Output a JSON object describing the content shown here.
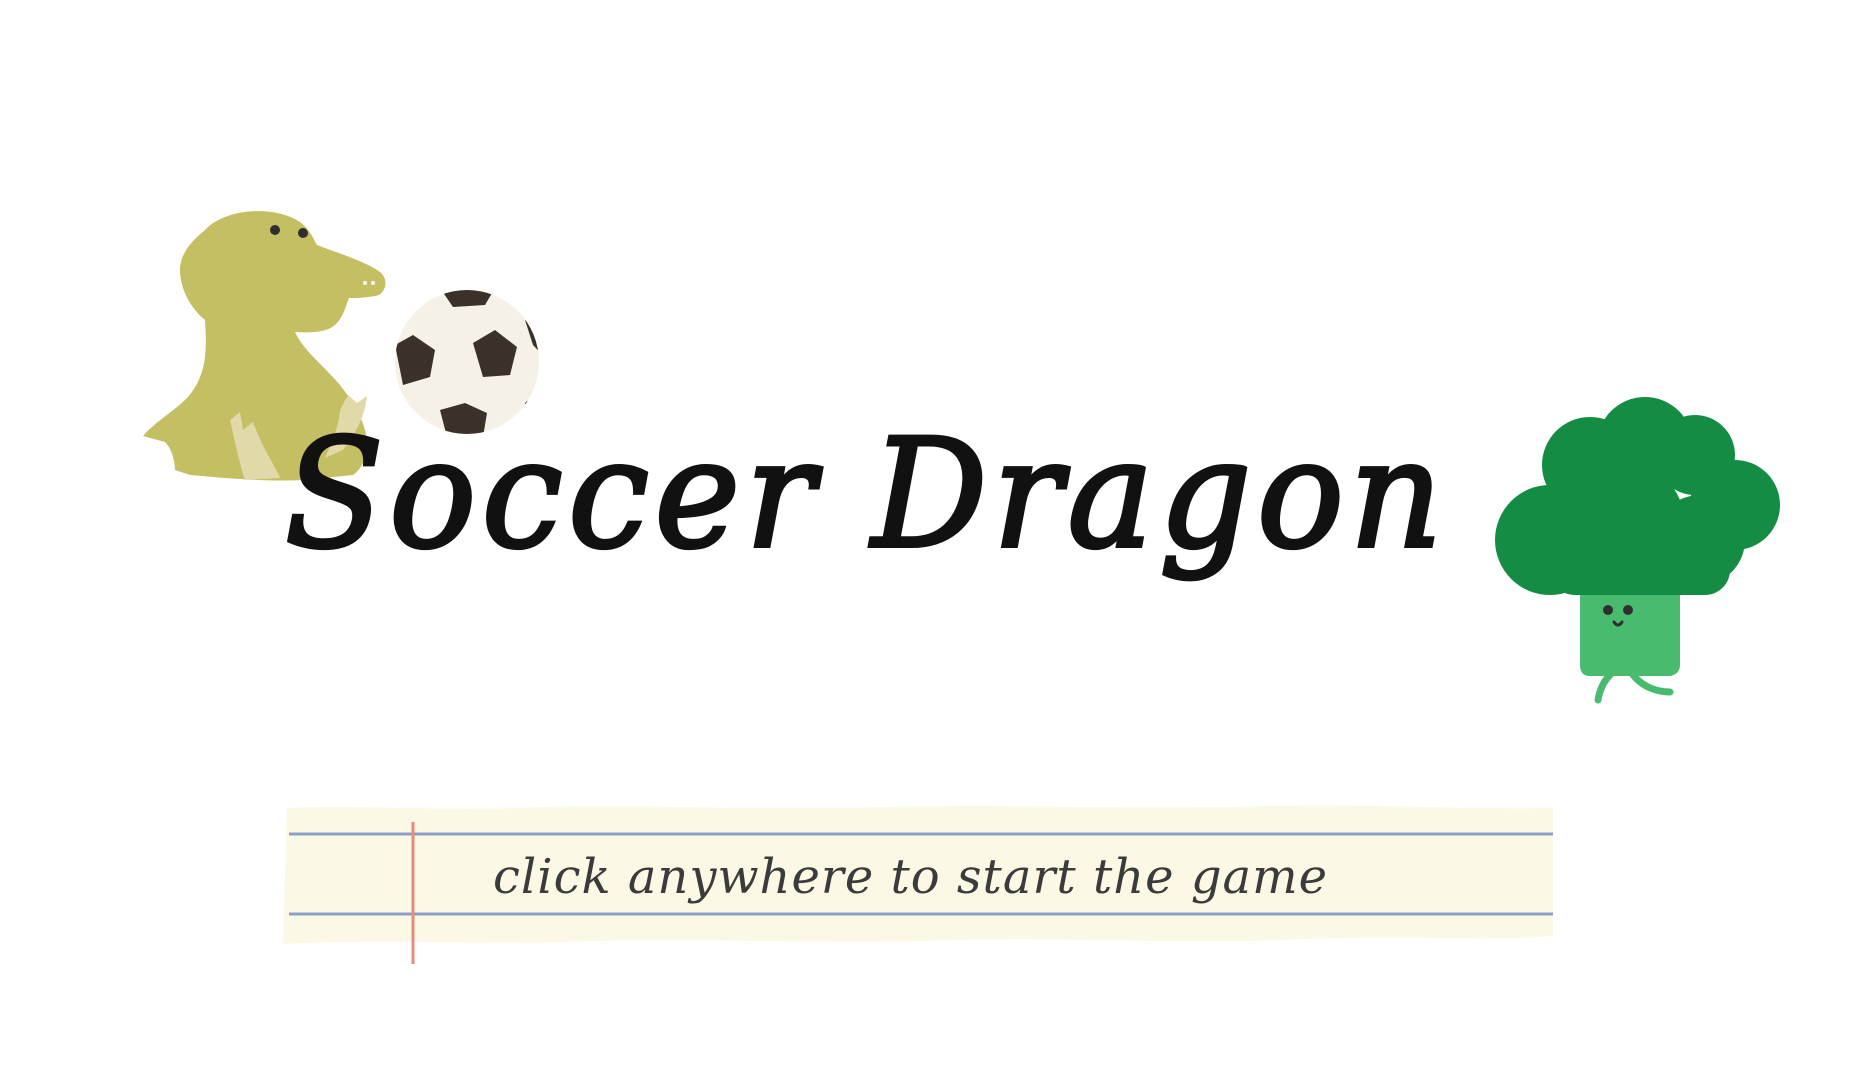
{
  "title": "Soccer Dragon",
  "start_prompt": "click anywhere to start the game",
  "colors": {
    "background": "#ffffff",
    "dragon": "#c5bf63",
    "dragon_belly": "#e2d9a8",
    "ball_light": "#f6f1e7",
    "ball_dark": "#3a3128",
    "broccoli_top": "#148c43",
    "broccoli_stem": "#48bb6e",
    "paper": "#fcf8e6",
    "paper_lines": "#8aa0c8",
    "paper_margin": "#e88a7c",
    "title_text": "#111111",
    "prompt_text": "#3b3b3b"
  },
  "icons": [
    "dragon-character",
    "soccer-ball",
    "broccoli-character",
    "notebook-paper"
  ]
}
